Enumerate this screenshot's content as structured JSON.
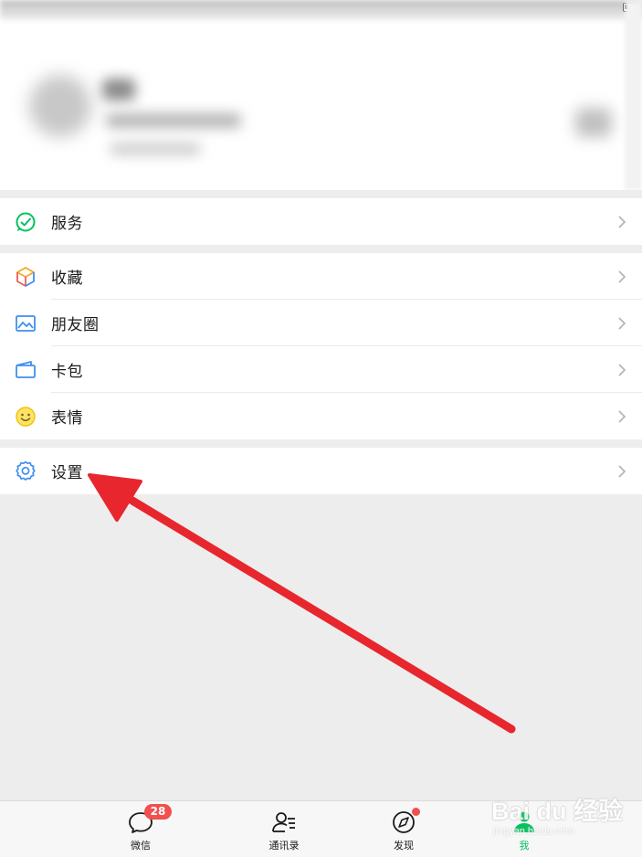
{
  "menu": {
    "group1": [
      {
        "label": "服务",
        "icon": "wechat-pay-icon"
      }
    ],
    "group2": [
      {
        "label": "收藏",
        "icon": "favorites-cube-icon"
      },
      {
        "label": "朋友圈",
        "icon": "moments-picture-icon"
      },
      {
        "label": "卡包",
        "icon": "card-wallet-icon"
      },
      {
        "label": "表情",
        "icon": "smile-emoji-icon"
      }
    ],
    "group3": [
      {
        "label": "设置",
        "icon": "gear-icon"
      }
    ]
  },
  "tabbar": {
    "tabs": [
      {
        "label": "微信",
        "icon": "chat-bubble-icon",
        "badge": "28"
      },
      {
        "label": "通讯录",
        "icon": "contacts-icon"
      },
      {
        "label": "发现",
        "icon": "compass-icon",
        "dot": true
      },
      {
        "label": "我",
        "icon": "person-icon",
        "active": true
      }
    ]
  },
  "watermark": {
    "logo": "Bai du 经验",
    "sub": "jingyan.baidu.com"
  },
  "colors": {
    "accent_green": "#07c160",
    "badge_red": "#f24f4f",
    "arrow_red": "#e8262d",
    "background": "#ededed"
  }
}
